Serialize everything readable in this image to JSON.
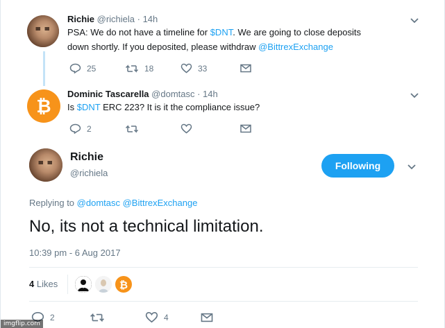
{
  "tweets": [
    {
      "name": "Richie",
      "handle_time": "@richiela · 14h",
      "text_line1_prefix": "PSA: We do not have a timeline for ",
      "text_line1_link": "$DNT",
      "text_line1_suffix": ".  We are going to close deposits",
      "text_line2_prefix": "down shortly.  If you deposited, please withdraw ",
      "text_line2_link": "@BittrexExchange",
      "replies": "25",
      "retweets": "18",
      "likes": "33"
    },
    {
      "name": "Dominic Tascarella",
      "handle_time": "@domtasc · 14h",
      "text_prefix": "Is ",
      "text_link": "$DNT",
      "text_suffix": " ERC 223? It is it the compliance issue?",
      "replies": "2",
      "retweets": "",
      "likes": ""
    }
  ],
  "main_tweet": {
    "name": "Richie",
    "handle": "@richiela",
    "follow_label": "Following",
    "replying_prefix": "Replying to ",
    "replying_to": "@domtasc @BittrexExchange",
    "text": "No, its not a technical limitation.",
    "timestamp": "10:39 pm - 6 Aug 2017",
    "like_count": "4",
    "like_label": "Likes",
    "replies": "2",
    "retweets": "",
    "likes": "4"
  },
  "watermark": "imgflip.com",
  "colors": {
    "accent": "#1da1f2",
    "bitcoin": "#f7931a",
    "muted": "#657786",
    "thread_line": "#c4e3f7"
  },
  "icons": [
    "reply-icon",
    "retweet-icon",
    "heart-icon",
    "envelope-icon",
    "chevron-down-icon",
    "bitcoin-icon"
  ]
}
